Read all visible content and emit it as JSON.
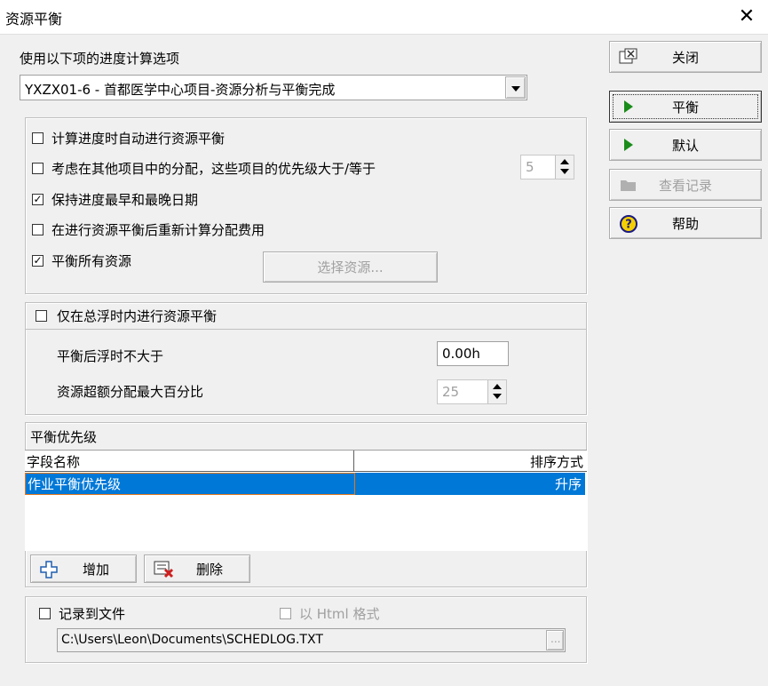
{
  "window": {
    "title": "资源平衡",
    "close_glyph": "✕"
  },
  "schedule_options": {
    "label": "使用以下项的进度计算选项",
    "selected": "YXZX01-6 - 首都医学中心项目-资源分析与平衡完成"
  },
  "options": {
    "auto_level": {
      "label": "计算进度时自动进行资源平衡",
      "checked": false
    },
    "consider_other_projects": {
      "label": "考虑在其他项目中的分配，这些项目的优先级大于/等于",
      "checked": false,
      "priority_value": "5"
    },
    "preserve_dates": {
      "label": "保持进度最早和最晚日期",
      "checked": true
    },
    "recalc_costs": {
      "label": "在进行资源平衡后重新计算分配费用",
      "checked": false
    },
    "level_all": {
      "label": "平衡所有资源",
      "checked": true
    },
    "select_resources_label": "选择资源..."
  },
  "float": {
    "header_label": "仅在总浮时内进行资源平衡",
    "checked": false,
    "preserve_float_label": "平衡后浮时不大于",
    "preserve_float_value": "0.00h",
    "overalloc_label": "资源超额分配最大百分比",
    "overalloc_value": "25"
  },
  "priority": {
    "title": "平衡优先级",
    "columns": [
      "字段名称",
      "排序方式"
    ],
    "rows": [
      {
        "field": "作业平衡优先级",
        "order": "升序"
      }
    ],
    "add_label": "增加",
    "delete_label": "删除"
  },
  "log": {
    "label": "记录到文件",
    "checked": false,
    "html_label": "以 Html 格式",
    "html_checked": false,
    "path": "C:\\Users\\Leon\\Documents\\SCHEDLOG.TXT",
    "browse_label": "..."
  },
  "side_buttons": {
    "close": "关闭",
    "level": "平衡",
    "default": "默认",
    "view_log": "查看记录",
    "help": "帮助"
  },
  "colors": {
    "selection": "#0078d7",
    "play_green": "#1a8c1a"
  }
}
